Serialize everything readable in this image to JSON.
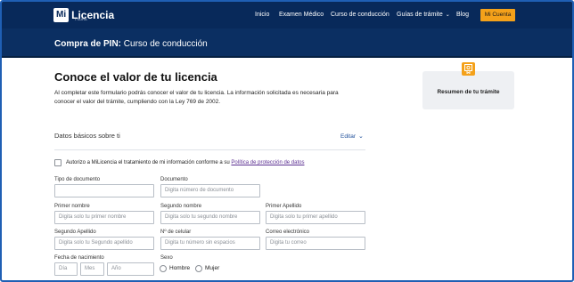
{
  "header": {
    "logo_mark": "Mi",
    "logo_text": "Licencia",
    "logo_sub": "• SURA",
    "nav": [
      "Inicio",
      "Examen Médico",
      "Curso de conducción",
      "Guías de trámite",
      "Blog"
    ],
    "account_label": "Mi Cuenta"
  },
  "band": {
    "title_bold": "Compra de PIN:",
    "title_rest": " Curso de conducción"
  },
  "main": {
    "heading": "Conoce el valor de tu licencia",
    "intro": "Al completar este formulario podrás conocer el valor de tu licencia. La información solicitada es necesaria para conocer el valor del trámite, cumpliendo con la Ley 769 de 2002."
  },
  "summary": {
    "label": "Resumen de tu trámite"
  },
  "form": {
    "section_title": "Datos básicos sobre ti",
    "edit_label": "Editar",
    "consent_text": "Autorizo a MiLicencia el tratamiento de mi información conforme a su ",
    "consent_link": "Política de protección de datos",
    "fields": {
      "tipo_doc": {
        "label": "Tipo de documento",
        "placeholder": ""
      },
      "documento": {
        "label": "Documento",
        "placeholder": "Digita número de documento"
      },
      "primer_nombre": {
        "label": "Primer nombre",
        "placeholder": "Digita solo tu primer nombre"
      },
      "segundo_nombre": {
        "label": "Segundo nombre",
        "placeholder": "Digita solo tu segundo nombre"
      },
      "primer_apellido": {
        "label": "Primer Apellido",
        "placeholder": "Digita solo tu primer apellido"
      },
      "segundo_apellido": {
        "label": "Segundo Apellido",
        "placeholder": "Digita solo tu Segundo apellido"
      },
      "celular": {
        "label": "Nº de celular",
        "placeholder": "Digita tu número sin espacios"
      },
      "correo": {
        "label": "Correo electrónico",
        "placeholder": "Digita tu correo"
      },
      "fecha": {
        "label": "Fecha de nacimiento",
        "dia": "Día",
        "mes": "Mes",
        "anio": "Año"
      },
      "sexo": {
        "label": "Sexo",
        "options": [
          "Hombre",
          "Mujer"
        ]
      }
    }
  }
}
